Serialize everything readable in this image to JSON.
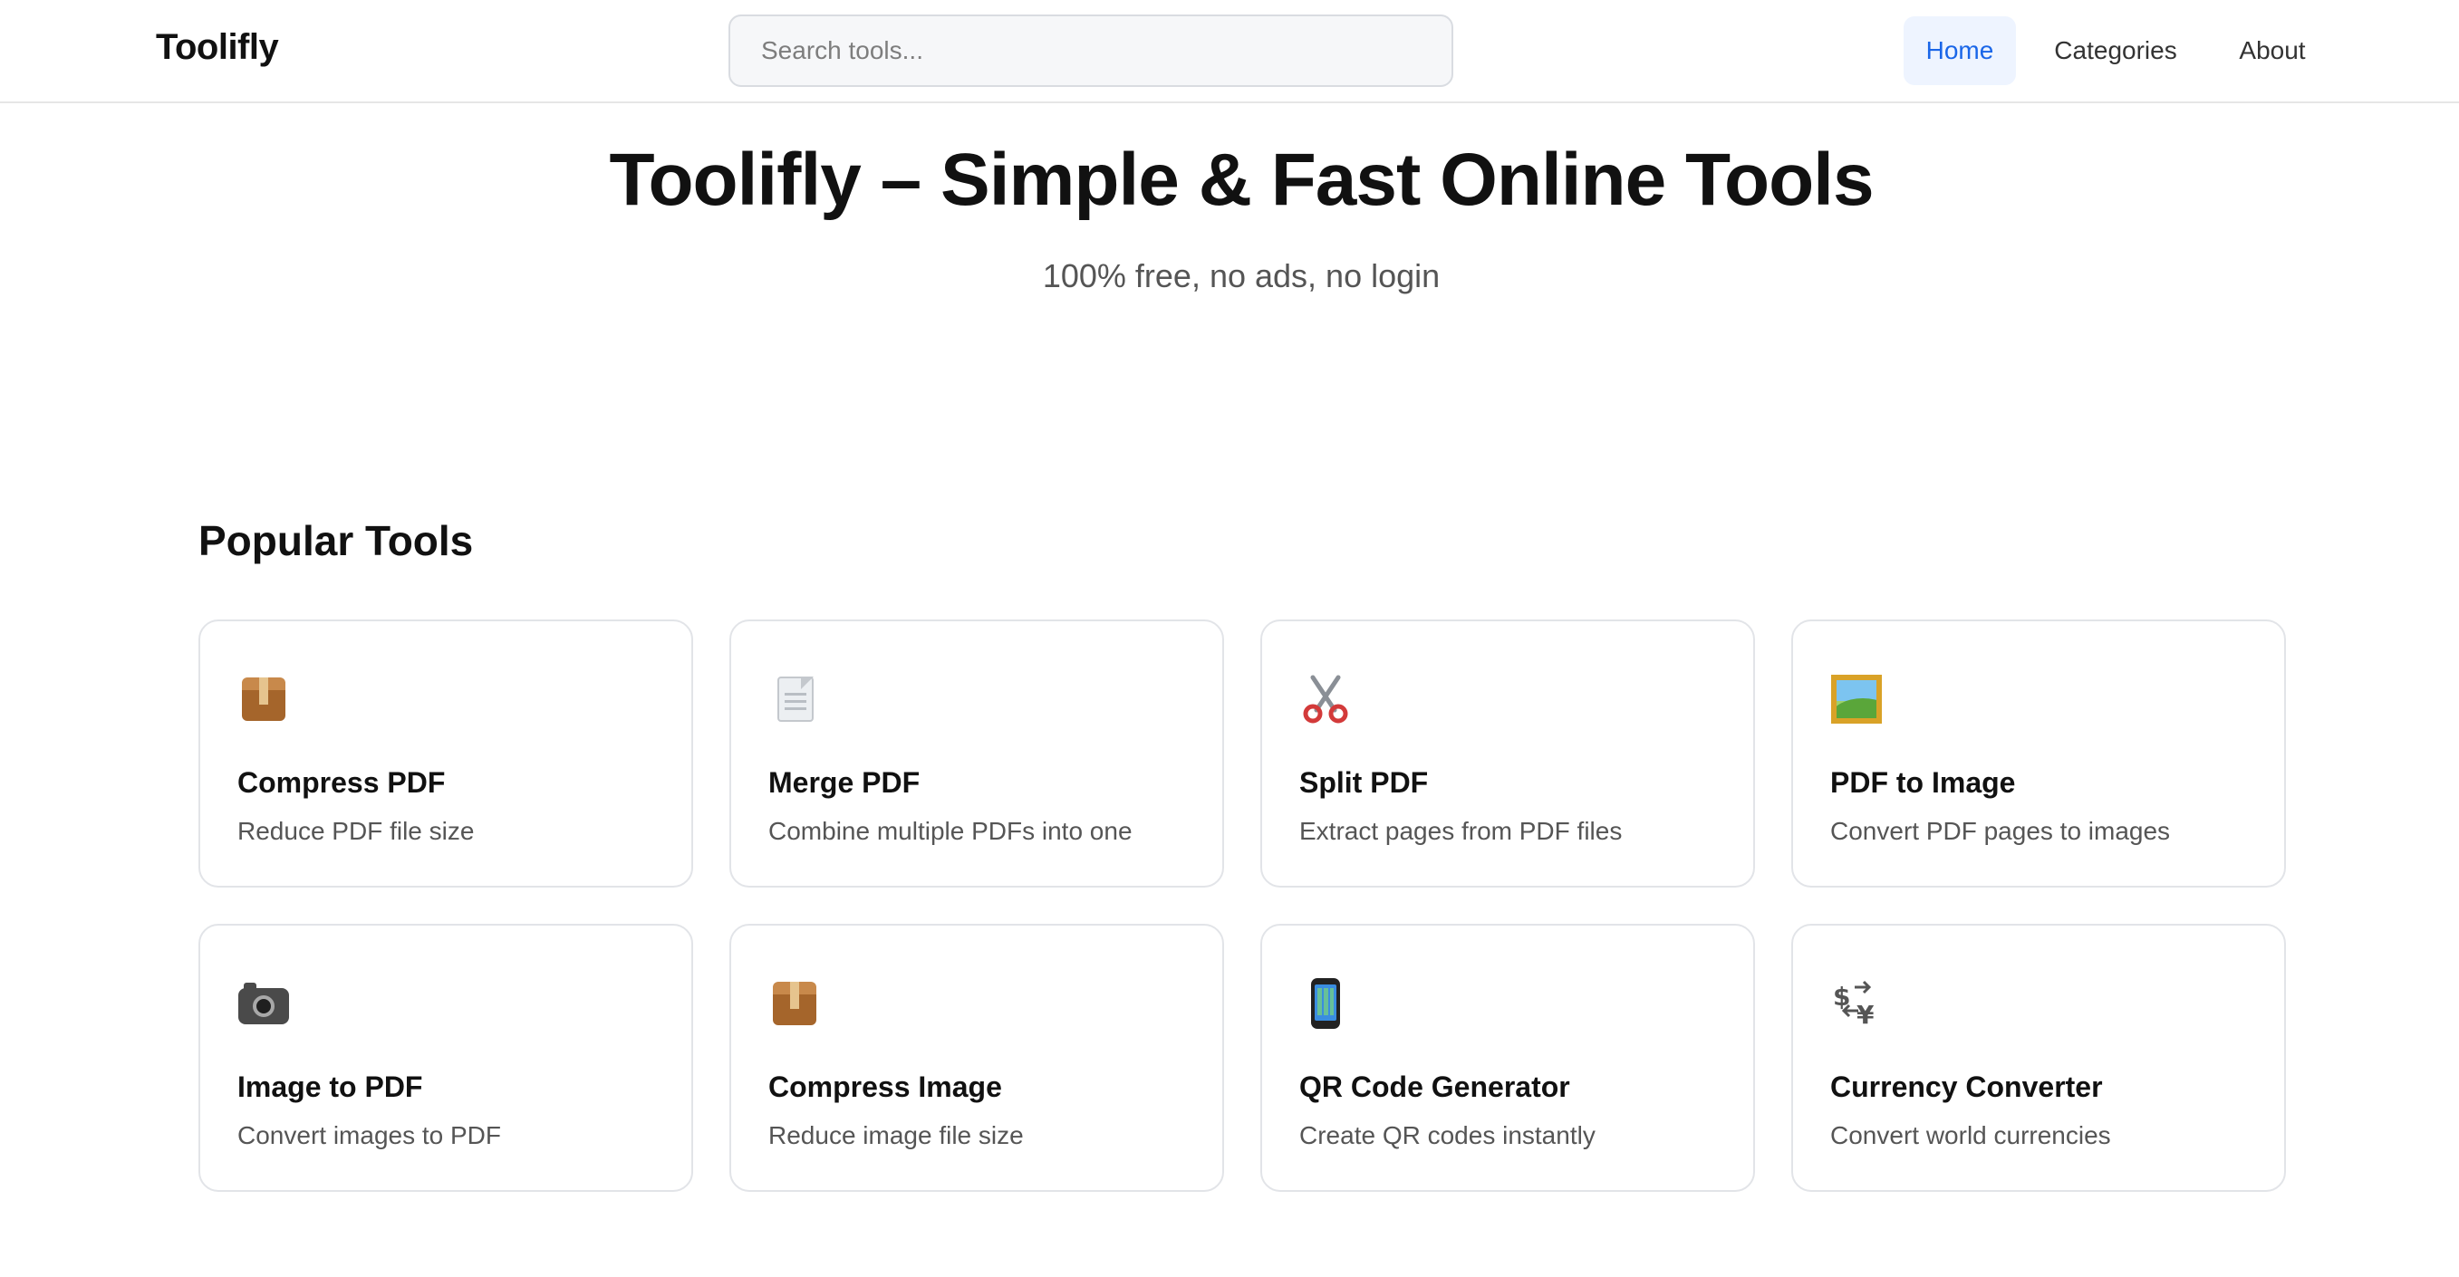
{
  "header": {
    "logo": "Toolifly",
    "search_placeholder": "Search tools...",
    "nav": [
      {
        "label": "Home",
        "active": true
      },
      {
        "label": "Categories",
        "active": false
      },
      {
        "label": "About",
        "active": false
      }
    ]
  },
  "hero": {
    "title": "Toolifly – Simple & Fast Online Tools",
    "subtitle": "100% free, no ads, no login"
  },
  "popular": {
    "heading": "Popular Tools",
    "tools": [
      {
        "icon": "package-icon",
        "title": "Compress PDF",
        "desc": "Reduce PDF file size"
      },
      {
        "icon": "document-icon",
        "title": "Merge PDF",
        "desc": "Combine multiple PDFs into one"
      },
      {
        "icon": "scissors-icon",
        "title": "Split PDF",
        "desc": "Extract pages from PDF files"
      },
      {
        "icon": "framed-picture-icon",
        "title": "PDF to Image",
        "desc": "Convert PDF pages to images"
      },
      {
        "icon": "camera-icon",
        "title": "Image to PDF",
        "desc": "Convert images to PDF"
      },
      {
        "icon": "package-icon",
        "title": "Compress Image",
        "desc": "Reduce image file size"
      },
      {
        "icon": "mobile-phone-icon",
        "title": "QR Code Generator",
        "desc": "Create QR codes instantly"
      },
      {
        "icon": "currency-exchange-icon",
        "title": "Currency Converter",
        "desc": "Convert world currencies"
      }
    ]
  },
  "colors": {
    "accent": "#1a66e8",
    "active_nav_bg": "#eef4ff",
    "card_border": "#e2e4e8"
  }
}
